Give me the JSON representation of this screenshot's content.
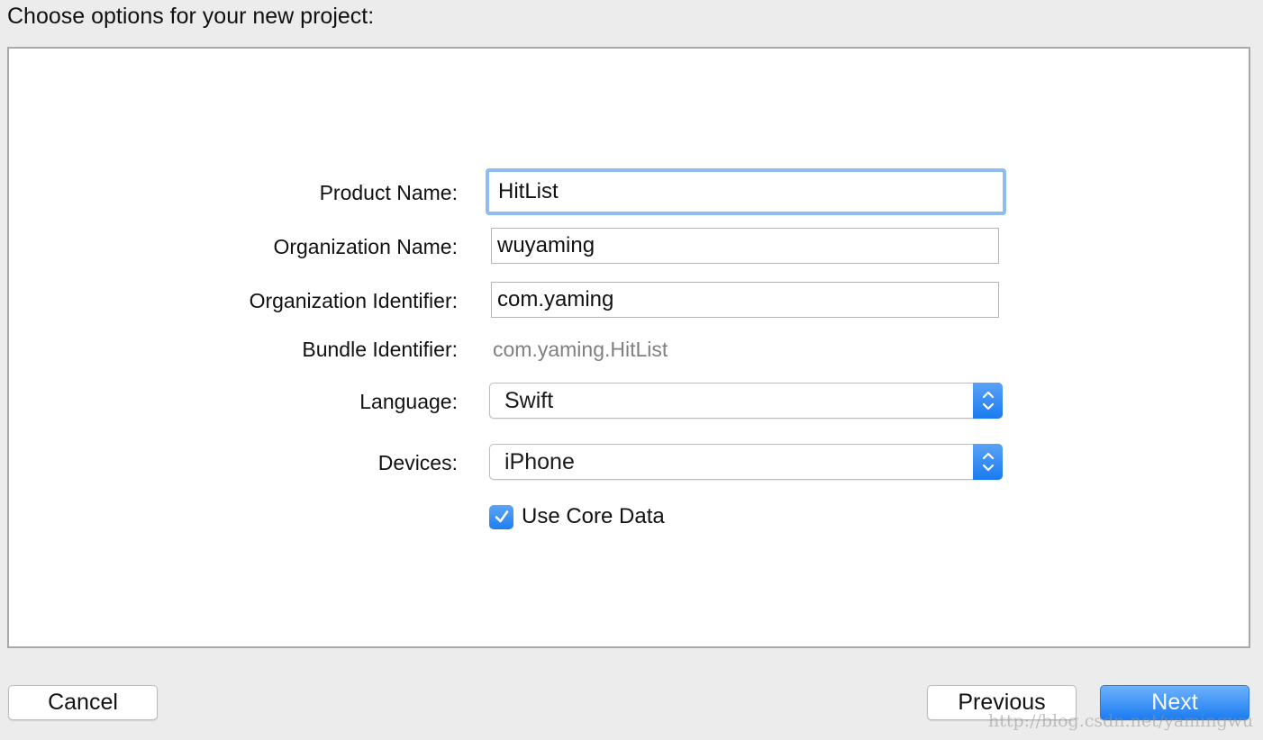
{
  "heading": "Choose options for your new project:",
  "form": {
    "product_name": {
      "label": "Product Name:",
      "value": "HitList"
    },
    "organization_name": {
      "label": "Organization Name:",
      "value": "wuyaming"
    },
    "organization_identifier": {
      "label": "Organization Identifier:",
      "value": "com.yaming"
    },
    "bundle_identifier": {
      "label": "Bundle Identifier:",
      "value": "com.yaming.HitList"
    },
    "language": {
      "label": "Language:",
      "value": "Swift"
    },
    "devices": {
      "label": "Devices:",
      "value": "iPhone"
    },
    "core_data": {
      "label": "Use Core Data",
      "checked": true
    }
  },
  "buttons": {
    "cancel": "Cancel",
    "previous": "Previous",
    "next": "Next"
  },
  "watermark": "http://blog.csdn.net/yamingwu",
  "colors": {
    "accent": "#1b7cf2",
    "focus_ring": "#8fbcf2",
    "window_bg": "#ececec"
  },
  "icons": {
    "popup_arrows": "chevron-up-down-icon",
    "checkbox_check": "checkmark-icon"
  }
}
